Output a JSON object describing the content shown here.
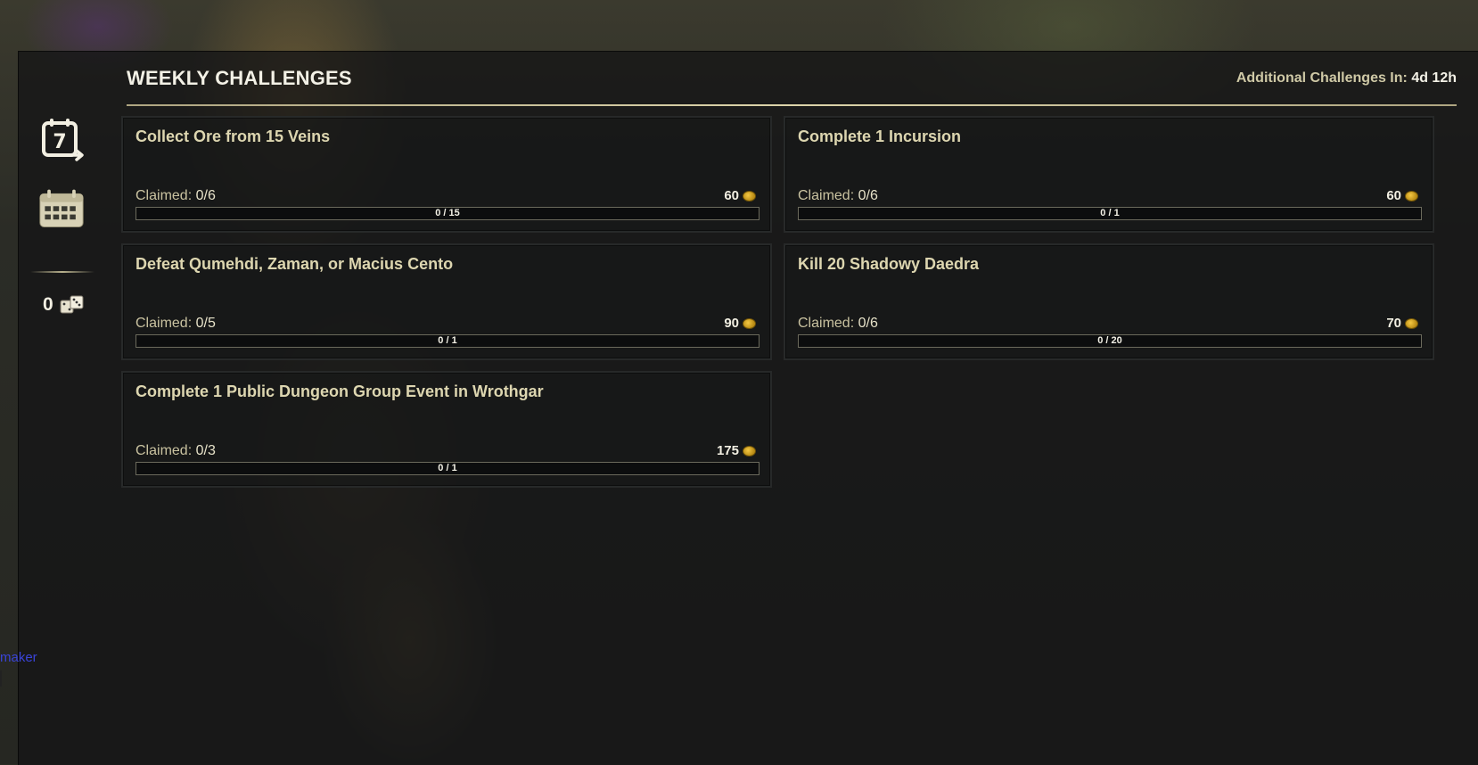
{
  "header": {
    "title": "WEEKLY CHALLENGES",
    "additional_label": "Additional Challenges In:",
    "additional_value": "4d 12h"
  },
  "sidebar": {
    "weekly_icon": "weekly-calendar-7-icon",
    "weekly_number": "7",
    "calendar_icon": "calendar-icon",
    "currency_amount": "0",
    "currency_icon": "dice-icon"
  },
  "challenges": [
    {
      "title": "Collect Ore from 15 Veins",
      "claimed_label": "Claimed:",
      "claimed": "0/6",
      "reward": "60",
      "progress": "0 / 15",
      "progress_fraction": 0
    },
    {
      "title": "Complete 1 Incursion",
      "claimed_label": "Claimed:",
      "claimed": "0/6",
      "reward": "60",
      "progress": "0 / 1",
      "progress_fraction": 0
    },
    {
      "title": "Defeat Qumehdi, Zaman, or Macius Cento",
      "claimed_label": "Claimed:",
      "claimed": "0/5",
      "reward": "90",
      "progress": "0 / 1",
      "progress_fraction": 0
    },
    {
      "title": "Kill 20 Shadowy Daedra",
      "claimed_label": "Claimed:",
      "claimed": "0/6",
      "reward": "70",
      "progress": "0 / 20",
      "progress_fraction": 0
    },
    {
      "title": "Complete 1 Public Dungeon Group Event in Wrothgar",
      "claimed_label": "Claimed:",
      "claimed": "0/3",
      "reward": "175",
      "progress": "0 / 1",
      "progress_fraction": 0
    }
  ],
  "background_fragment": "maker",
  "colors": {
    "accent": "#ddd6b0",
    "title": "#f3f1e6",
    "reward_coin": "#e0ad2a"
  }
}
